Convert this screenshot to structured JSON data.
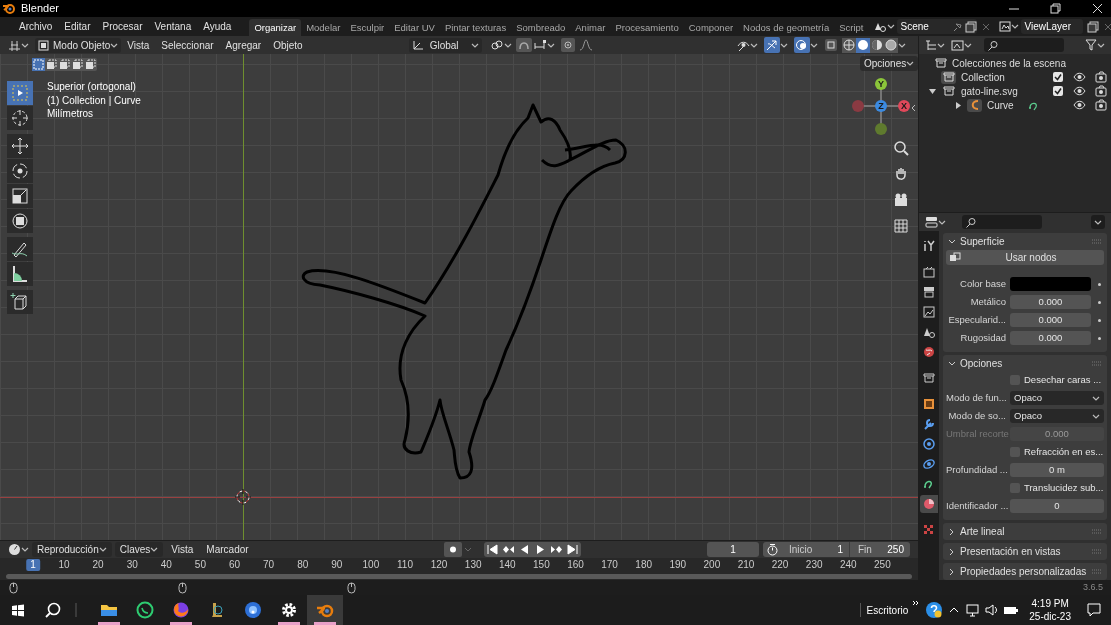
{
  "window": {
    "title": "Blender"
  },
  "menu": [
    "Archivo",
    "Editar",
    "Procesar",
    "Ventana",
    "Ayuda"
  ],
  "workspaces": [
    {
      "label": "Organizar",
      "selected": true
    },
    {
      "label": "Modelar",
      "selected": false
    },
    {
      "label": "Esculpir",
      "selected": false
    },
    {
      "label": "Editar UV",
      "selected": false
    },
    {
      "label": "Pintar texturas",
      "selected": false
    },
    {
      "label": "Sombreado",
      "selected": false
    },
    {
      "label": "Animar",
      "selected": false
    },
    {
      "label": "Procesamiento",
      "selected": false
    },
    {
      "label": "Componer",
      "selected": false
    },
    {
      "label": "Nodos de geometría",
      "selected": false
    },
    {
      "label": "Script",
      "selected": false
    }
  ],
  "scene": "Scene",
  "view_layer": "ViewLayer",
  "viewport": {
    "mode": "Modo Objeto",
    "menus": [
      "Vista",
      "Seleccionar",
      "Agregar",
      "Objeto"
    ],
    "transform": "Global",
    "options": "Opciones",
    "shading": [
      {
        "kind": "wire",
        "selected": false
      },
      {
        "kind": "solid",
        "selected": true
      },
      {
        "kind": "material",
        "selected": false
      },
      {
        "kind": "render",
        "selected": false
      }
    ],
    "overlay_text": [
      "Superior (ortogonal)",
      "(1) Collection | Curve",
      "Milímetros"
    ],
    "tools": [
      {
        "kind": "select",
        "selected": true
      },
      {
        "kind": "cursor",
        "selected": false
      },
      {
        "kind": "move",
        "selected": false
      },
      {
        "kind": "rotate",
        "selected": false
      },
      {
        "kind": "scale",
        "selected": false
      },
      {
        "kind": "transform",
        "selected": false
      },
      {
        "kind": "annotate",
        "selected": false
      },
      {
        "kind": "measure",
        "selected": false
      },
      {
        "kind": "add",
        "selected": false
      }
    ],
    "gizmo": {
      "y": "Y",
      "z": "Z",
      "x": "X"
    }
  },
  "outliner": {
    "root": "Colecciones de la escena",
    "items": [
      {
        "name": "Collection",
        "kind": "collection",
        "checked": true
      },
      {
        "name": "gato-line.svg",
        "kind": "collection",
        "checked": true,
        "expanded": true,
        "children": [
          {
            "name": "Curve",
            "kind": "curve",
            "expanded": false
          }
        ]
      }
    ]
  },
  "properties": {
    "tabs": [
      {
        "kind": "tool",
        "selected": false
      },
      {
        "kind": "render",
        "selected": false
      },
      {
        "kind": "output",
        "selected": false
      },
      {
        "kind": "view",
        "selected": false
      },
      {
        "kind": "scene",
        "selected": false
      },
      {
        "kind": "world",
        "selected": false
      },
      {
        "kind": "collection",
        "selected": false
      },
      {
        "kind": "object",
        "selected": false
      },
      {
        "kind": "modifier",
        "selected": false
      },
      {
        "kind": "particles",
        "selected": false
      },
      {
        "kind": "physics",
        "selected": false
      },
      {
        "kind": "data",
        "selected": false
      },
      {
        "kind": "material",
        "selected": true
      },
      {
        "kind": "texture",
        "selected": false
      }
    ],
    "panels": [
      {
        "title": "Superficie",
        "expanded": true,
        "button": "Usar nodos",
        "rows": [
          {
            "kind": "color",
            "label": "Color base",
            "color": "#000000"
          },
          {
            "kind": "number",
            "label": "Metálico",
            "value": "0.000",
            "disabled": false
          },
          {
            "kind": "number",
            "label": "Especularid...",
            "value": "0.000",
            "disabled": false
          },
          {
            "kind": "number",
            "label": "Rugosidad",
            "value": "0.000",
            "disabled": false
          }
        ]
      },
      {
        "title": "Opciones",
        "expanded": true,
        "rows": [
          {
            "kind": "checkbox",
            "label": "Desechar caras ...",
            "checked": false
          },
          {
            "kind": "select",
            "label": "Modo de fun...",
            "value": "Opaco"
          },
          {
            "kind": "select",
            "label": "Modo de so...",
            "value": "Opaco"
          },
          {
            "kind": "number",
            "label": "Umbral recorte",
            "value": "0.000",
            "disabled": true
          },
          {
            "kind": "checkbox",
            "label": "Refracción en es...",
            "checked": false
          },
          {
            "kind": "number",
            "label": "Profundidad ...",
            "value": "0 m",
            "disabled": false
          },
          {
            "kind": "checkbox",
            "label": "Translucidez sub...",
            "checked": false
          },
          {
            "kind": "number",
            "label": "Identificador ...",
            "value": "0",
            "disabled": false
          }
        ]
      },
      {
        "title": "Arte lineal",
        "expanded": false
      },
      {
        "title": "Presentación en vistas",
        "expanded": false
      },
      {
        "title": "Propiedades personalizadas",
        "expanded": false
      }
    ]
  },
  "timeline": {
    "menus": [
      {
        "label": "Reproducción",
        "dropdown": true
      },
      {
        "label": "Claves",
        "dropdown": true
      },
      {
        "label": "Vista",
        "dropdown": false
      },
      {
        "label": "Marcador",
        "dropdown": false
      }
    ],
    "current_frame": "1",
    "start_label": "Inicio",
    "start": "1",
    "end_label": "Fin",
    "end": "250",
    "ruler": [
      "1",
      "10",
      "20",
      "30",
      "40",
      "50",
      "60",
      "70",
      "80",
      "90",
      "100",
      "110",
      "120",
      "130",
      "140",
      "150",
      "160",
      "170",
      "180",
      "190",
      "200",
      "210",
      "220",
      "230",
      "240",
      "250"
    ]
  },
  "version": "3.6.5",
  "taskbar": {
    "apps": [
      {
        "kind": "files",
        "running": true
      },
      {
        "kind": "chat",
        "running": false
      },
      {
        "kind": "browser",
        "running": true
      },
      {
        "kind": "game",
        "running": false
      },
      {
        "kind": "disc",
        "running": false
      },
      {
        "kind": "settings",
        "running": true
      },
      {
        "kind": "blender",
        "running": true
      }
    ],
    "desktop": "Escritorio",
    "time": "4:19 PM",
    "date": "25-dic-23"
  }
}
